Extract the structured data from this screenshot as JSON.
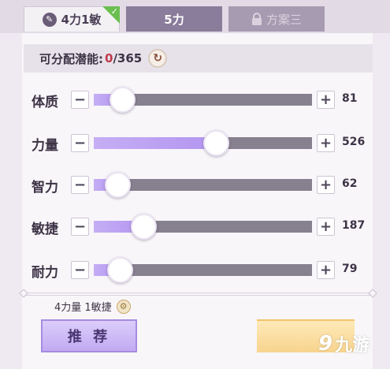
{
  "tabs": [
    {
      "label": "4力1敏",
      "active": true,
      "checked": true
    },
    {
      "label": "5力",
      "active": false
    },
    {
      "label": "方案三",
      "locked": true
    }
  ],
  "points": {
    "label": "可分配潜能:",
    "used": "0",
    "total": "/365"
  },
  "stats": [
    {
      "name": "体质",
      "value": "81",
      "level": 0.13
    },
    {
      "name": "力量",
      "value": "526",
      "level": 0.56
    },
    {
      "name": "智力",
      "value": "62",
      "level": 0.11
    },
    {
      "name": "敏捷",
      "value": "187",
      "level": 0.23
    },
    {
      "name": "耐力",
      "value": "79",
      "level": 0.12
    }
  ],
  "controls": {
    "minus": "−",
    "plus": "+"
  },
  "summary": "4力量 1敏捷",
  "buttons": {
    "recommend": "推 荐"
  },
  "watermark": {
    "logo": "9",
    "text": "九游"
  },
  "colors": {
    "fill": "#b395ef",
    "track": "#87808f",
    "active_tab": "#f4f1f5",
    "check": "#6bbf4f"
  }
}
